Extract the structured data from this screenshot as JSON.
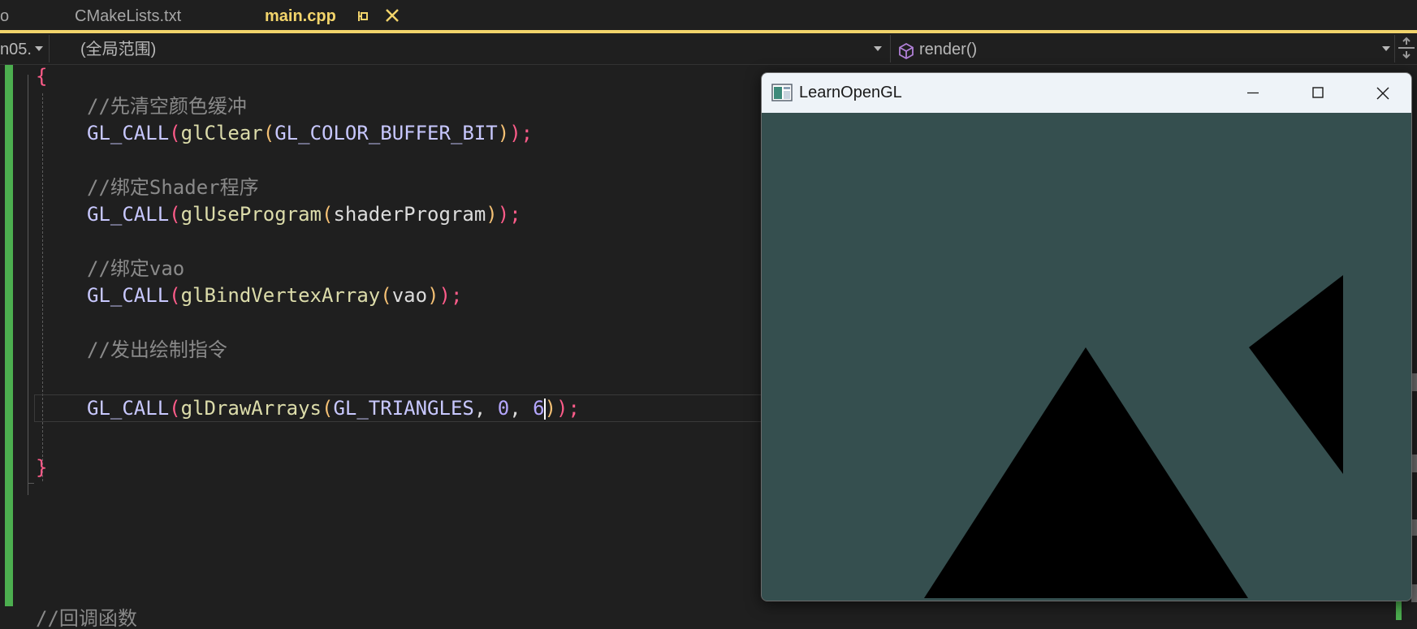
{
  "tabs": {
    "left_stub": "o",
    "cmake": "CMakeLists.txt",
    "active": "main.cpp",
    "pin_glyph": "⊣",
    "close_glyph": "✕"
  },
  "nav": {
    "project": "n05.",
    "scope": "(全局范围)",
    "member": "render()"
  },
  "code": {
    "open_brace": "{",
    "comment1": "//先清空颜色缓冲",
    "l1": {
      "macro": "GL_CALL",
      "p1": "(",
      "fn": "glClear",
      "p2": "(",
      "arg": "GL_COLOR_BUFFER_BIT",
      "p3": ")",
      "p4": ")",
      "semi": ";"
    },
    "comment2": "//绑定Shader程序",
    "l2": {
      "macro": "GL_CALL",
      "p1": "(",
      "fn": "glUseProgram",
      "p2": "(",
      "arg": "shaderProgram",
      "p3": ")",
      "p4": ")",
      "semi": ";"
    },
    "comment3": "//绑定vao",
    "l3": {
      "macro": "GL_CALL",
      "p1": "(",
      "fn": "glBindVertexArray",
      "p2": "(",
      "arg": "vao",
      "p3": ")",
      "p4": ")",
      "semi": ";"
    },
    "comment4": "//发出绘制指令",
    "l4": {
      "macro": "GL_CALL",
      "p1": "(",
      "fn": "glDrawArrays",
      "p2": "(",
      "arg": "GL_TRIANGLES",
      "comma1": ", ",
      "n1": "0",
      "comma2": ", ",
      "n2": "6",
      "p3": ")",
      "p4": ")",
      "semi": ";"
    },
    "close_brace": "}",
    "comment5": "//回调函数"
  },
  "gl_window": {
    "title": "LearnOpenGL",
    "clear_color": "#354f4f",
    "triangle_color": "#000000"
  },
  "colors": {
    "accent": "#f2d46b",
    "change_bar": "#4cae4f",
    "editor_bg": "#1f1f1f"
  }
}
